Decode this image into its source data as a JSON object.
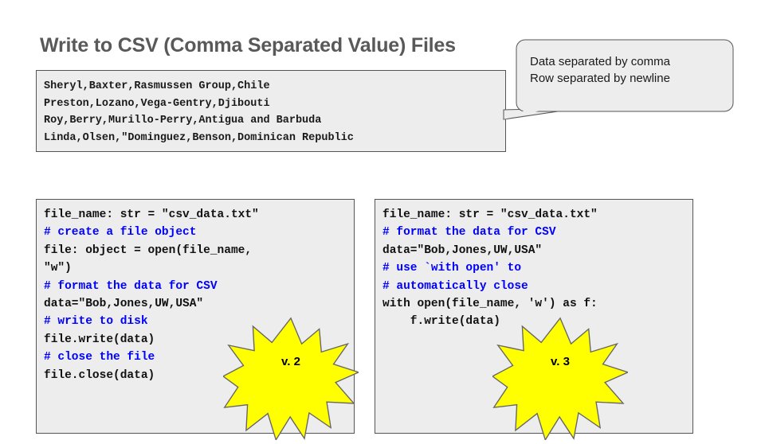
{
  "slide": {
    "title": "Write to CSV (Comma Separated Value) Files",
    "title_color": "#595959",
    "background": "#ffffff"
  },
  "csv_sample": {
    "name": "csv-sample-box",
    "background": "#ededed",
    "border_color": "#555555",
    "lines": [
      "Sheryl,Baxter,Rasmussen Group,Chile",
      "Preston,Lozano,Vega-Gentry,Djibouti",
      "Roy,Berry,Murillo-Perry,Antigua and Barbuda",
      "Linda,Olsen,\"Dominguez,Benson,Dominican Republic"
    ]
  },
  "callout": {
    "background": "#ededed",
    "border_color": "#555555",
    "lines": [
      "Data separated by comma",
      "Row separated by newline"
    ]
  },
  "code_panels": [
    {
      "id": "left",
      "background": "#ededed",
      "border_color": "#555555",
      "comment_color": "#0000ff",
      "code_color": "#111111",
      "lines": [
        {
          "text": "file_name: str = \"csv_data.txt\"",
          "type": "code"
        },
        {
          "text": "# create a file object",
          "type": "comment"
        },
        {
          "text": "file: object = open(file_name,",
          "type": "code"
        },
        {
          "text": "\"w\")",
          "type": "code"
        },
        {
          "text": "# format the data for CSV",
          "type": "comment"
        },
        {
          "text": "data=\"Bob,Jones,UW,USA\"",
          "type": "code"
        },
        {
          "text": "# write to disk",
          "type": "comment"
        },
        {
          "text": "file.write(data)",
          "type": "code"
        },
        {
          "text": "# close the file",
          "type": "comment"
        },
        {
          "text": "file.close(data)",
          "type": "code"
        }
      ],
      "badge": "v. 2"
    },
    {
      "id": "right",
      "background": "#ededed",
      "border_color": "#555555",
      "comment_color": "#0000ff",
      "code_color": "#111111",
      "lines": [
        {
          "text": "file_name: str = \"csv_data.txt\"",
          "type": "code"
        },
        {
          "text": "# format the data for CSV",
          "type": "comment"
        },
        {
          "text": "data=\"Bob,Jones,UW,USA\"",
          "type": "code"
        },
        {
          "text": "# use `with open' to",
          "type": "comment"
        },
        {
          "text": "# automatically close",
          "type": "comment"
        },
        {
          "text": "with open(file_name, 'w') as f:",
          "type": "code"
        },
        {
          "text": "    f.write(data)",
          "type": "code"
        }
      ],
      "badge": "v. 3"
    }
  ],
  "badges": {
    "v2_label": "v. 2",
    "v3_label": "v. 3",
    "fill_color": "#ffff00",
    "stroke_color": "#666666"
  }
}
